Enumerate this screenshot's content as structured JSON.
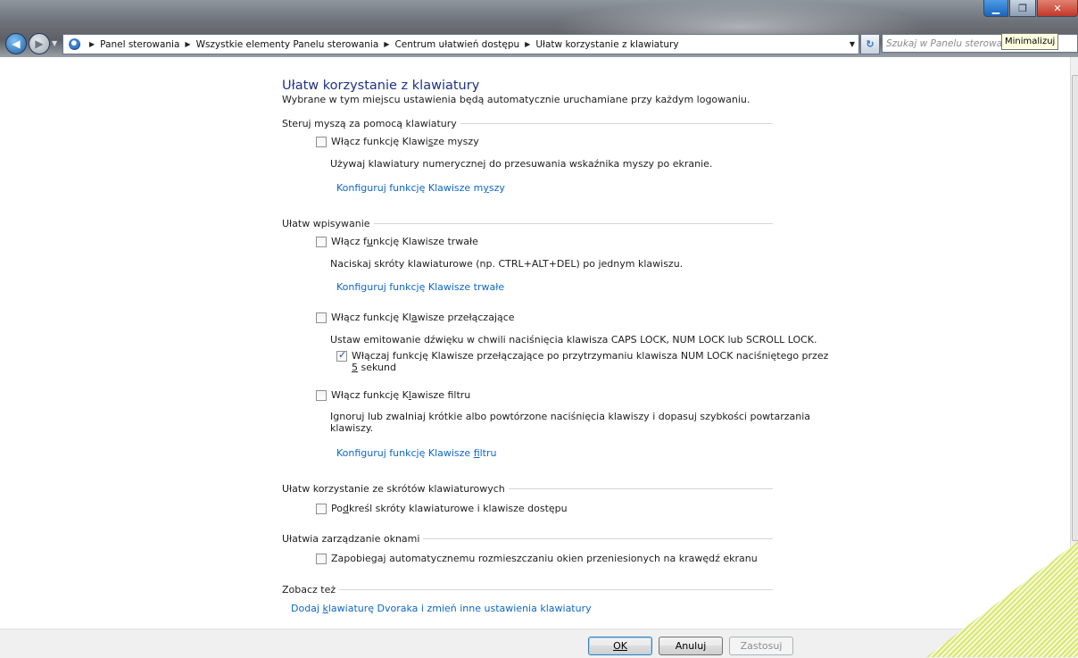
{
  "window": {
    "minimize_tooltip": "Minimalizuj"
  },
  "navigation": {
    "breadcrumbs": [
      "Panel sterowania",
      "Wszystkie elementy Panelu sterowania",
      "Centrum ułatwień dostępu",
      "Ułatw korzystanie z klawiatury"
    ],
    "search_placeholder": "Szukaj w Panelu sterowania"
  },
  "page": {
    "title": "Ułatw korzystanie z klawiatury",
    "subtitle": "Wybrane w tym miejscu ustawienia będą automatycznie uruchamiane przy każdym logowaniu."
  },
  "mouse_section": {
    "heading": "Steruj myszą za pomocą klawiatury",
    "mouse_keys": {
      "checked": false,
      "label": "Włącz funkcję Klawisze myszy",
      "description": "Używaj klawiatury numerycznej do przesuwania wskaźnika myszy po ekranie.",
      "link": "Konfiguruj funkcję Klawisze myszy"
    }
  },
  "typing_section": {
    "heading": "Ułatw wpisywanie",
    "sticky_keys": {
      "checked": false,
      "label": "Włącz funkcję Klawisze trwałe",
      "description": "Naciskaj skróty klawiaturowe (np. CTRL+ALT+DEL) po jednym klawiszu.",
      "link": "Konfiguruj funkcję Klawisze trwałe"
    },
    "toggle_keys": {
      "checked": false,
      "label": "Włącz funkcję Klawisze przełączające",
      "description": "Ustaw emitowanie dźwięku w chwili naciśnięcia klawisza CAPS LOCK, NUM LOCK lub SCROLL LOCK.",
      "sub_option": {
        "checked": true,
        "label_line1": "Włączaj funkcję Klawisze przełączające po przytrzymaniu klawisza NUM LOCK naciśniętego przez",
        "label_line2": "5 sekund"
      }
    },
    "filter_keys": {
      "checked": false,
      "label": "Włącz funkcję Klawisze filtru",
      "description_line1": "Ignoruj lub zwalniaj krótkie albo powtórzone naciśnięcia klawiszy i dopasuj szybkości powtarzania",
      "description_line2": "klawiszy.",
      "link": "Konfiguruj funkcję Klawisze filtru"
    }
  },
  "shortcuts_section": {
    "heading": "Ułatw korzystanie ze skrótów klawiaturowych",
    "underline": {
      "checked": false,
      "label": "Podkreśl skróty klawiaturowe i klawisze dostępu"
    }
  },
  "windows_section": {
    "heading": "Ułatwia zarządzanie oknami",
    "prevent_arrange": {
      "checked": false,
      "label": "Zapobiegaj automatycznemu rozmieszczaniu okien przeniesionych na krawędź ekranu"
    }
  },
  "see_also": {
    "heading": "Zobacz też",
    "links": [
      "Dodaj klawiaturę Dvoraka i zmień inne ustawienia klawiatury"
    ]
  },
  "buttons": {
    "ok": "OK",
    "cancel": "Anuluj",
    "apply": "Zastosuj"
  },
  "colors": {
    "title": "#1e3287",
    "link": "#0e66c9"
  }
}
